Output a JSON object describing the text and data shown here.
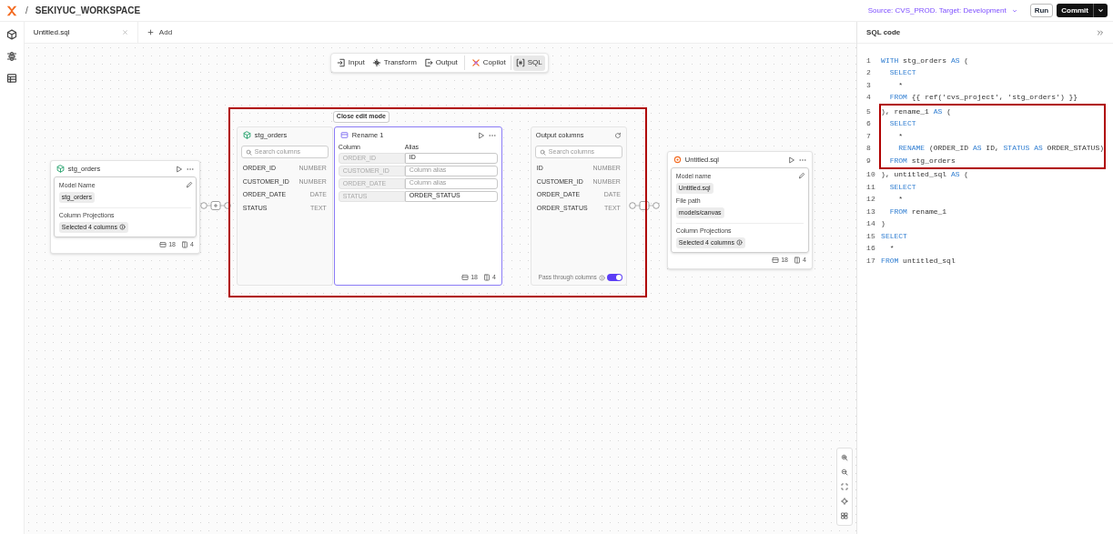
{
  "header": {
    "workspace": "SEKIYUC_WORKSPACE",
    "separator": "/",
    "environment": "Source: CVS_PROD. Target: Development",
    "run_button": "Run",
    "commit_button": "Commit"
  },
  "tabs": [
    {
      "label": "Untitled.sql",
      "selected": true
    }
  ],
  "add_tab": "Add",
  "toolbar": [
    {
      "kind": "input",
      "label": "Input",
      "selected": false
    },
    {
      "kind": "transform",
      "label": "Transform",
      "selected": false
    },
    {
      "kind": "output",
      "label": "Output",
      "selected": false
    },
    {
      "kind": "copilot",
      "label": "Copilot",
      "selected": false
    },
    {
      "kind": "sql",
      "label": "SQL",
      "selected": true
    }
  ],
  "source_node": {
    "title": "stg_orders",
    "fields": [
      {
        "label": "Model Name",
        "value": "stg_orders"
      }
    ],
    "projection_label": "Column Projections",
    "projection_value": "Selected 4 columns",
    "rows_count": "18",
    "columns_count": "4"
  },
  "edit_mode": {
    "highlighted": true,
    "close_button": "Close edit mode",
    "input_panel": {
      "title": "stg_orders",
      "search_placeholder": "Search columns",
      "columns": [
        {
          "name": "ORDER_ID",
          "type": "NUMBER"
        },
        {
          "name": "CUSTOMER_ID",
          "type": "NUMBER"
        },
        {
          "name": "ORDER_DATE",
          "type": "DATE"
        },
        {
          "name": "STATUS",
          "type": "TEXT"
        }
      ]
    },
    "rename": {
      "title": "Rename 1",
      "column_header": "Column",
      "alias_header": "Alias",
      "rows": [
        {
          "column": "ORDER_ID",
          "alias": "ID"
        },
        {
          "column": "CUSTOMER_ID",
          "placeholder": "Column alias"
        },
        {
          "column": "ORDER_DATE",
          "placeholder": "Column alias"
        },
        {
          "column": "STATUS",
          "alias": "ORDER_STATUS"
        }
      ],
      "rows_count": "18",
      "columns_count": "4"
    },
    "output_panel": {
      "title": "Output columns",
      "search_placeholder": "Search columns",
      "columns": [
        {
          "name": "ID",
          "type": "NUMBER"
        },
        {
          "name": "CUSTOMER_ID",
          "type": "NUMBER"
        },
        {
          "name": "ORDER_DATE",
          "type": "DATE"
        },
        {
          "name": "ORDER_STATUS",
          "type": "TEXT"
        }
      ],
      "pass_through_label": "Pass through columns",
      "pass_through_on": true
    }
  },
  "target_node": {
    "title": "Untitled.sql",
    "fields": [
      {
        "label": "Model name",
        "value": "Untitled.sql"
      },
      {
        "label": "File path",
        "value": "models/canvas"
      }
    ],
    "projection_label": "Column Projections",
    "projection_value": "Selected 4 columns",
    "rows_count": "18",
    "columns_count": "4"
  },
  "sql_panel": {
    "title": "SQL code",
    "lines": [
      {
        "number": "1",
        "highlighted": false,
        "tokens": [
          {
            "kind": "keyword",
            "text": "WITH"
          },
          {
            "kind": "plain",
            "text": " stg_orders "
          },
          {
            "kind": "keyword",
            "text": "AS"
          },
          {
            "kind": "plain",
            "text": " ("
          }
        ]
      },
      {
        "number": "2",
        "highlighted": false,
        "tokens": [
          {
            "kind": "keyword",
            "text": "  SELECT"
          }
        ]
      },
      {
        "number": "3",
        "highlighted": false,
        "tokens": [
          {
            "kind": "plain",
            "text": "    *"
          }
        ]
      },
      {
        "number": "4",
        "highlighted": false,
        "tokens": [
          {
            "kind": "keyword",
            "text": "  FROM"
          },
          {
            "kind": "plain",
            "text": " {{ ref('cvs_project', 'stg_orders') }}"
          }
        ]
      },
      {
        "number": "5",
        "highlighted": true,
        "tokens": [
          {
            "kind": "plain",
            "text": "), rename_1 "
          },
          {
            "kind": "keyword",
            "text": "AS"
          },
          {
            "kind": "plain",
            "text": " ("
          }
        ]
      },
      {
        "number": "6",
        "highlighted": true,
        "tokens": [
          {
            "kind": "keyword",
            "text": "  SELECT"
          }
        ]
      },
      {
        "number": "7",
        "highlighted": true,
        "tokens": [
          {
            "kind": "plain",
            "text": "    *"
          }
        ]
      },
      {
        "number": "8",
        "highlighted": true,
        "tokens": [
          {
            "kind": "keyword",
            "text": "    RENAME"
          },
          {
            "kind": "plain",
            "text": " (ORDER_ID "
          },
          {
            "kind": "keyword",
            "text": "AS"
          },
          {
            "kind": "plain",
            "text": " ID, "
          },
          {
            "kind": "keyword",
            "text": "STATUS AS"
          },
          {
            "kind": "plain",
            "text": " ORDER_STATUS)"
          }
        ]
      },
      {
        "number": "9",
        "highlighted": true,
        "tokens": [
          {
            "kind": "keyword",
            "text": "  FROM"
          },
          {
            "kind": "plain",
            "text": " stg_orders"
          }
        ]
      },
      {
        "number": "10",
        "highlighted": false,
        "tokens": [
          {
            "kind": "plain",
            "text": "), untitled_sql "
          },
          {
            "kind": "keyword",
            "text": "AS"
          },
          {
            "kind": "plain",
            "text": " ("
          }
        ]
      },
      {
        "number": "11",
        "highlighted": false,
        "tokens": [
          {
            "kind": "keyword",
            "text": "  SELECT"
          }
        ]
      },
      {
        "number": "12",
        "highlighted": false,
        "tokens": [
          {
            "kind": "plain",
            "text": "    *"
          }
        ]
      },
      {
        "number": "13",
        "highlighted": false,
        "tokens": [
          {
            "kind": "keyword",
            "text": "  FROM"
          },
          {
            "kind": "plain",
            "text": " rename_1"
          }
        ]
      },
      {
        "number": "14",
        "highlighted": false,
        "tokens": [
          {
            "kind": "plain",
            "text": ")"
          }
        ]
      },
      {
        "number": "15",
        "highlighted": false,
        "tokens": [
          {
            "kind": "keyword",
            "text": "SELECT"
          }
        ]
      },
      {
        "number": "16",
        "highlighted": false,
        "tokens": [
          {
            "kind": "plain",
            "text": "  *"
          }
        ]
      },
      {
        "number": "17",
        "highlighted": false,
        "tokens": [
          {
            "kind": "keyword",
            "text": "FROM"
          },
          {
            "kind": "plain",
            "text": " untitled_sql"
          }
        ]
      }
    ]
  }
}
